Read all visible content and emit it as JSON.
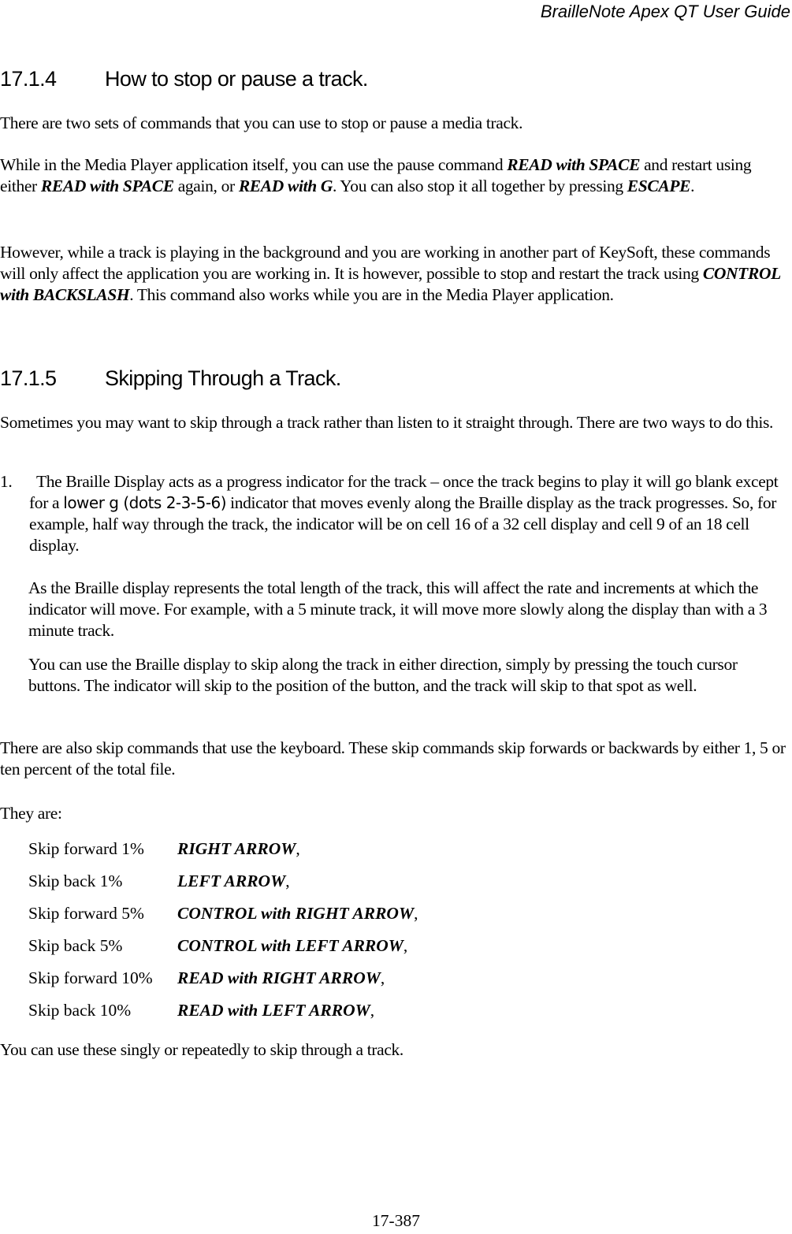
{
  "header": {
    "title": "BrailleNote Apex QT User Guide"
  },
  "section_1": {
    "number": "17.1.4",
    "title": "How to stop or pause a track.",
    "paragraphs": [
      {
        "text": "There are two sets of commands that you can use to stop or pause a media track."
      },
      {
        "t1": "While in the Media Player application itself, you can use the pause command ",
        "c1": "READ with SPACE",
        "t2": " and restart using either ",
        "c2": "READ with SPACE",
        "t3": " again, or ",
        "c3": "READ with G",
        "t4": ". You can also stop it all together by pressing ",
        "c4": "ESCAPE",
        "t5": "."
      },
      {
        "t1": "However, while a track is playing in the background and you are working in another part of KeySoft, these commands will only affect the application you are working in. It is however, possible to stop and restart the track using ",
        "c1": "CONTROL with BACKSLASH",
        "t2": ". This command also works while you are in the Media Player application."
      }
    ]
  },
  "section_2": {
    "number": "17.1.5",
    "title": "Skipping Through a Track.",
    "intro": "Sometimes you may want to skip through a track rather than listen to it straight through. There are two ways to do this.",
    "list": [
      {
        "marker": "1.",
        "t1": "The Braille Display acts as a progress indicator for the track – once the track begins to play it will go blank except for a ",
        "braille": "lower g (dots 2-3-5-6)",
        "t2": " indicator that moves evenly along the Braille display as the track progresses. So, for example, half way through the track, the indicator will be on cell 16 of a 32 cell display and cell 9 of an 18 cell display."
      }
    ],
    "indented_paragraphs": [
      "As the Braille display represents the total length of the track, this will affect the rate and increments at which the indicator will move. For example, with a 5 minute track, it will move more slowly along the display than with a 3 minute track.",
      "You can use the Braille display to skip along the track in either direction, simply by pressing the touch cursor buttons. The indicator will skip to the position of the button, and the track will skip to that spot as well."
    ],
    "keyboard_intro": "There are also skip commands that use the keyboard. These skip commands skip forwards or backwards by either 1, 5 or ten percent of the total file.",
    "they_are": "They are:",
    "commands": [
      {
        "action": "Skip forward 1%",
        "keys": "RIGHT ARROW",
        "sep": ","
      },
      {
        "action": "Skip back 1%",
        "keys": "LEFT ARROW",
        "sep": ","
      },
      {
        "action": "Skip forward 5%",
        "keys": "CONTROL with RIGHT ARROW",
        "sep": ","
      },
      {
        "action": "Skip back 5%",
        "keys": "CONTROL with LEFT ARROW",
        "sep": ","
      },
      {
        "action": "Skip forward 10%",
        "keys": "READ with RIGHT ARROW",
        "sep": ","
      },
      {
        "action": "Skip back 10%",
        "keys": "READ with LEFT ARROW",
        "sep": ","
      }
    ],
    "closing": "You can use these singly or repeatedly to skip through a track."
  },
  "footer": {
    "page_number": "17-387"
  }
}
